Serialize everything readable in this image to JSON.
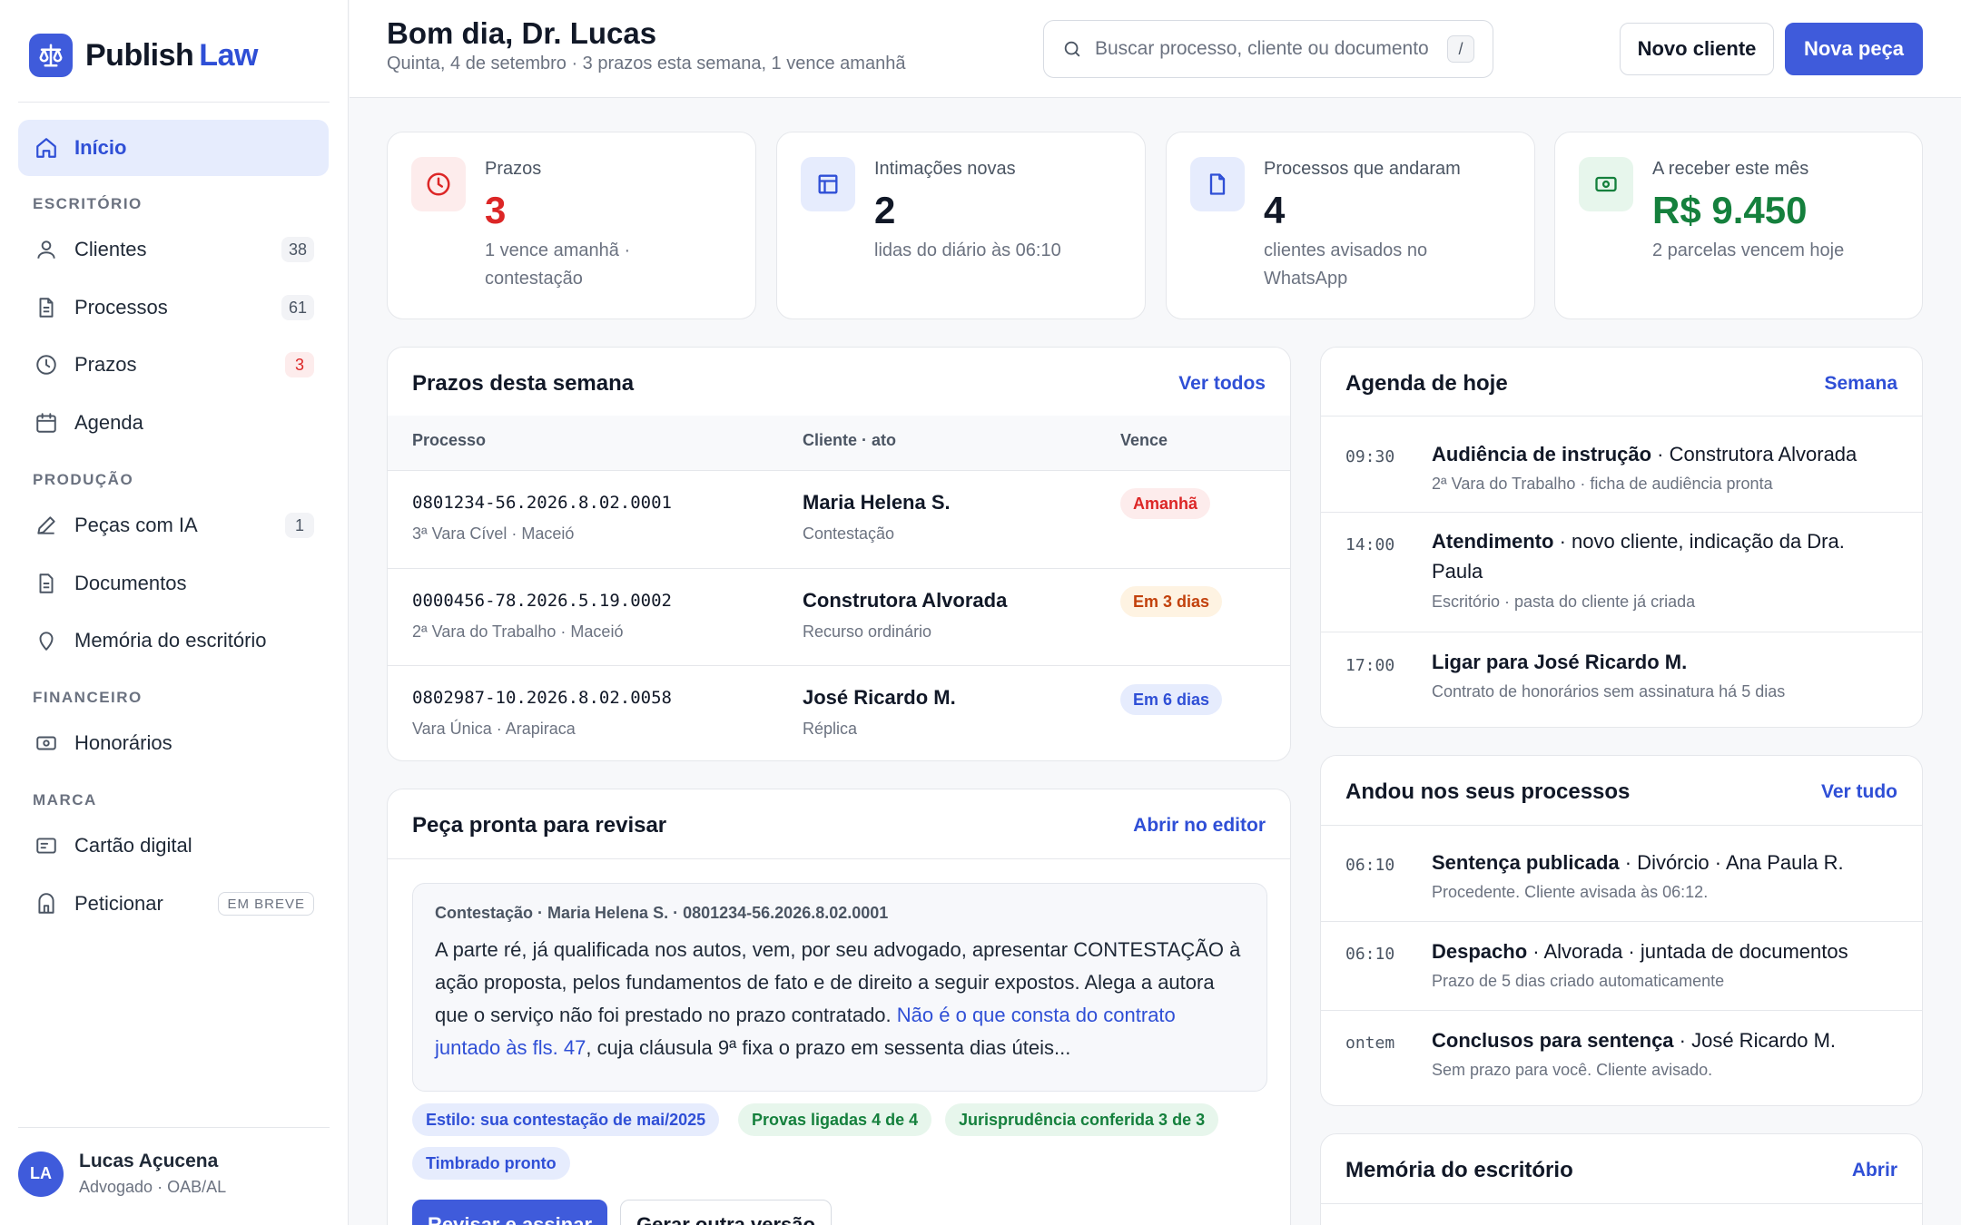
{
  "brand": {
    "name_part1": "Publish",
    "name_part2": "Law"
  },
  "sidebar": {
    "home": "Início",
    "sections": {
      "office": "ESCRITÓRIO",
      "production": "PRODUÇÃO",
      "finance": "FINANCEIRO",
      "brand": "MARCA"
    },
    "clients": {
      "label": "Clientes",
      "count": "38"
    },
    "processes": {
      "label": "Processos",
      "count": "61"
    },
    "deadlines": {
      "label": "Prazos",
      "count": "3"
    },
    "agenda": {
      "label": "Agenda"
    },
    "ai_pieces": {
      "label": "Peças com IA",
      "count": "1"
    },
    "documents": {
      "label": "Documentos"
    },
    "memory": {
      "label": "Memória do escritório"
    },
    "fees": {
      "label": "Honorários"
    },
    "card": {
      "label": "Cartão digital"
    },
    "petition": {
      "label": "Peticionar",
      "badge": "EM BREVE"
    },
    "user": {
      "initials": "LA",
      "name": "Lucas Açucena",
      "role": "Advogado · OAB/AL"
    }
  },
  "header": {
    "greeting": "Bom dia, Dr. Lucas",
    "subtitle": "Quinta, 4 de setembro · 3 prazos esta semana, 1 vence amanhã",
    "search_placeholder": "Buscar processo, cliente ou documento",
    "search_shortcut": "/",
    "new_client": "Novo cliente",
    "new_piece": "Nova peça"
  },
  "stats": [
    {
      "label": "Prazos",
      "value": "3",
      "desc": "1 vence amanhã · contestação",
      "color": "#dc2626"
    },
    {
      "label": "Intimações novas",
      "value": "2",
      "desc": "lidas do diário às 06:10",
      "color": "#111827"
    },
    {
      "label": "Processos que andaram",
      "value": "4",
      "desc": "clientes avisados no WhatsApp",
      "color": "#111827"
    },
    {
      "label": "A receber este mês",
      "value": "R$ 9.450",
      "desc": "2 parcelas vencem hoje",
      "color": "#15803d"
    }
  ],
  "deadlines": {
    "title": "Prazos desta semana",
    "link": "Ver todos",
    "headers": {
      "process": "Processo",
      "client": "Cliente · ato",
      "due": "Vence"
    },
    "rows": [
      {
        "number": "0801234-56.2026.8.02.0001",
        "court": "3ª Vara Cível · Maceió",
        "client": "Maria Helena S.",
        "act": "Contestação",
        "due": "Amanhã"
      },
      {
        "number": "0000456-78.2026.5.19.0002",
        "court": "2ª Vara do Trabalho · Maceió",
        "client": "Construtora Alvorada",
        "act": "Recurso ordinário",
        "due": "Em 3 dias"
      },
      {
        "number": "0802987-10.2026.8.02.0058",
        "court": "Vara Única · Arapiraca",
        "client": "José Ricardo M.",
        "act": "Réplica",
        "due": "Em 6 dias"
      }
    ]
  },
  "review": {
    "title": "Peça pronta para revisar",
    "link": "Abrir no editor",
    "meta": "Contestação · Maria Helena S. · 0801234-56.2026.8.02.0001",
    "text_before": "A parte ré, já qualificada nos autos, vem, por seu advogado, apresentar CONTESTAÇÃO à ação proposta, pelos fundamentos de fato e de direito a seguir expostos. Alega a autora que o serviço não foi prestado no prazo contratado. ",
    "text_highlight": "Não é o que consta do contrato juntado às fls. 47",
    "text_after": ", cuja cláusula 9ª fixa o prazo em sessenta dias úteis...",
    "tags": [
      "Estilo: sua contestação de mai/2025",
      "Provas ligadas 4 de 4",
      "Jurisprudência conferida 3 de 3",
      "Timbrado pronto"
    ],
    "review_button": "Revisar e assinar",
    "regenerate_button": "Gerar outra versão"
  },
  "agenda": {
    "title": "Agenda de hoje",
    "link": "Semana",
    "items": [
      {
        "time": "09:30",
        "title_bold": "Audiência de instrução",
        "title_rest": " · Construtora Alvorada",
        "sub": "2ª Vara do Trabalho · ficha de audiência pronta"
      },
      {
        "time": "14:00",
        "title_bold": "Atendimento",
        "title_rest": " · novo cliente, indicação da Dra. Paula",
        "sub": "Escritório · pasta do cliente já criada"
      },
      {
        "time": "17:00",
        "title_bold": "Ligar para José Ricardo M.",
        "title_rest": "",
        "sub": "Contrato de honorários sem assinatura há 5 dias"
      }
    ]
  },
  "moves": {
    "title": "Andou nos seus processos",
    "link": "Ver tudo",
    "items": [
      {
        "time": "06:10",
        "title_bold": "Sentença publicada",
        "title_rest": " · Divórcio · Ana Paula R.",
        "sub": "Procedente. Cliente avisada às 06:12."
      },
      {
        "time": "06:10",
        "title_bold": "Despacho",
        "title_rest": " · Alvorada · juntada de documentos",
        "sub": "Prazo de 5 dias criado automaticamente"
      },
      {
        "time": "ontem",
        "title_bold": "Conclusos para sentença",
        "title_rest": " · José Ricardo M.",
        "sub": "Sem prazo para você. Cliente avisado."
      }
    ]
  },
  "memory": {
    "title": "Memória do escritório",
    "link": "Abrir"
  }
}
